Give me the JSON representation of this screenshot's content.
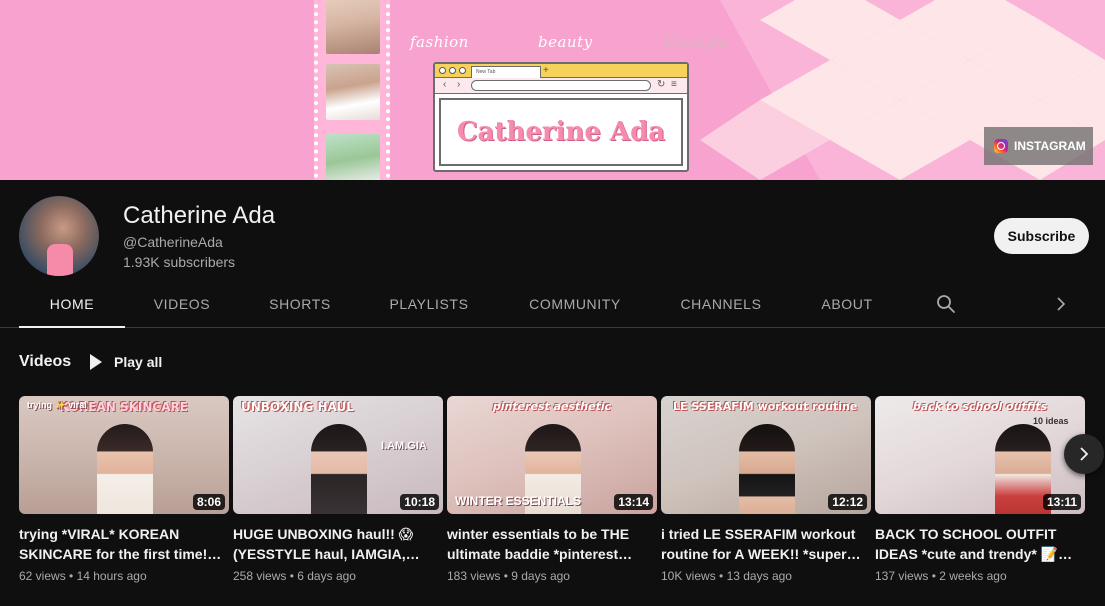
{
  "banner": {
    "words": [
      "fashion",
      "beauty",
      "lifestyle"
    ],
    "browser_tab": "New Tab",
    "logo_text": "Catherine Ada",
    "instagram_label": "INSTAGRAM"
  },
  "channel": {
    "name": "Catherine Ada",
    "handle": "@CatherineAda",
    "subscribers": "1.93K subscribers",
    "subscribe_label": "Subscribe"
  },
  "tabs": [
    {
      "label": "HOME",
      "active": true
    },
    {
      "label": "VIDEOS",
      "active": false
    },
    {
      "label": "SHORTS",
      "active": false
    },
    {
      "label": "PLAYLISTS",
      "active": false
    },
    {
      "label": "COMMUNITY",
      "active": false
    },
    {
      "label": "CHANNELS",
      "active": false
    },
    {
      "label": "ABOUT",
      "active": false
    }
  ],
  "section": {
    "title": "Videos",
    "play_all": "Play all"
  },
  "videos": [
    {
      "thumb_text": "KOREAN SKINCARE",
      "thumb_text2": "trying ✨ viral",
      "duration": "8:06",
      "title": "trying *VIRAL* KOREAN SKINCARE for the first time!…",
      "views": "62 views",
      "age": "14 hours ago"
    },
    {
      "thumb_text": "UNBOXING      HAUL",
      "thumb_text2": "I.AM.GIA",
      "duration": "10:18",
      "title": "HUGE UNBOXING haul!! 😱 (YESSTYLE haul, IAMGIA,…",
      "views": "258 views",
      "age": "6 days ago"
    },
    {
      "thumb_text": "pinterest aesthetic",
      "thumb_text2": "WINTER ESSENTIALS",
      "duration": "13:14",
      "title": "winter essentials to be THE ultimate baddie *pinterest…",
      "views": "183 views",
      "age": "9 days ago"
    },
    {
      "thumb_text": "LE SSERAFIM   workout routine",
      "thumb_text2": "",
      "duration": "12:12",
      "title": "i tried LE SSERAFIM workout routine for A WEEK!! *super…",
      "views": "10K views",
      "age": "13 days ago"
    },
    {
      "thumb_text": "back to school outfits",
      "thumb_text2": "10 ideas",
      "duration": "13:11",
      "title": "BACK TO SCHOOL OUTFIT IDEAS *cute and trendy* 📝…",
      "views": "137 views",
      "age": "2 weeks ago"
    }
  ],
  "colors": {
    "background": "#0f0f0f",
    "text_primary": "#f1f1f1",
    "text_secondary": "#aaaaaa",
    "banner_pink": "#f8a3cf"
  },
  "icons": {
    "search": "search-icon",
    "next": "chevron-right-icon",
    "play": "play-icon",
    "instagram": "instagram-icon"
  }
}
